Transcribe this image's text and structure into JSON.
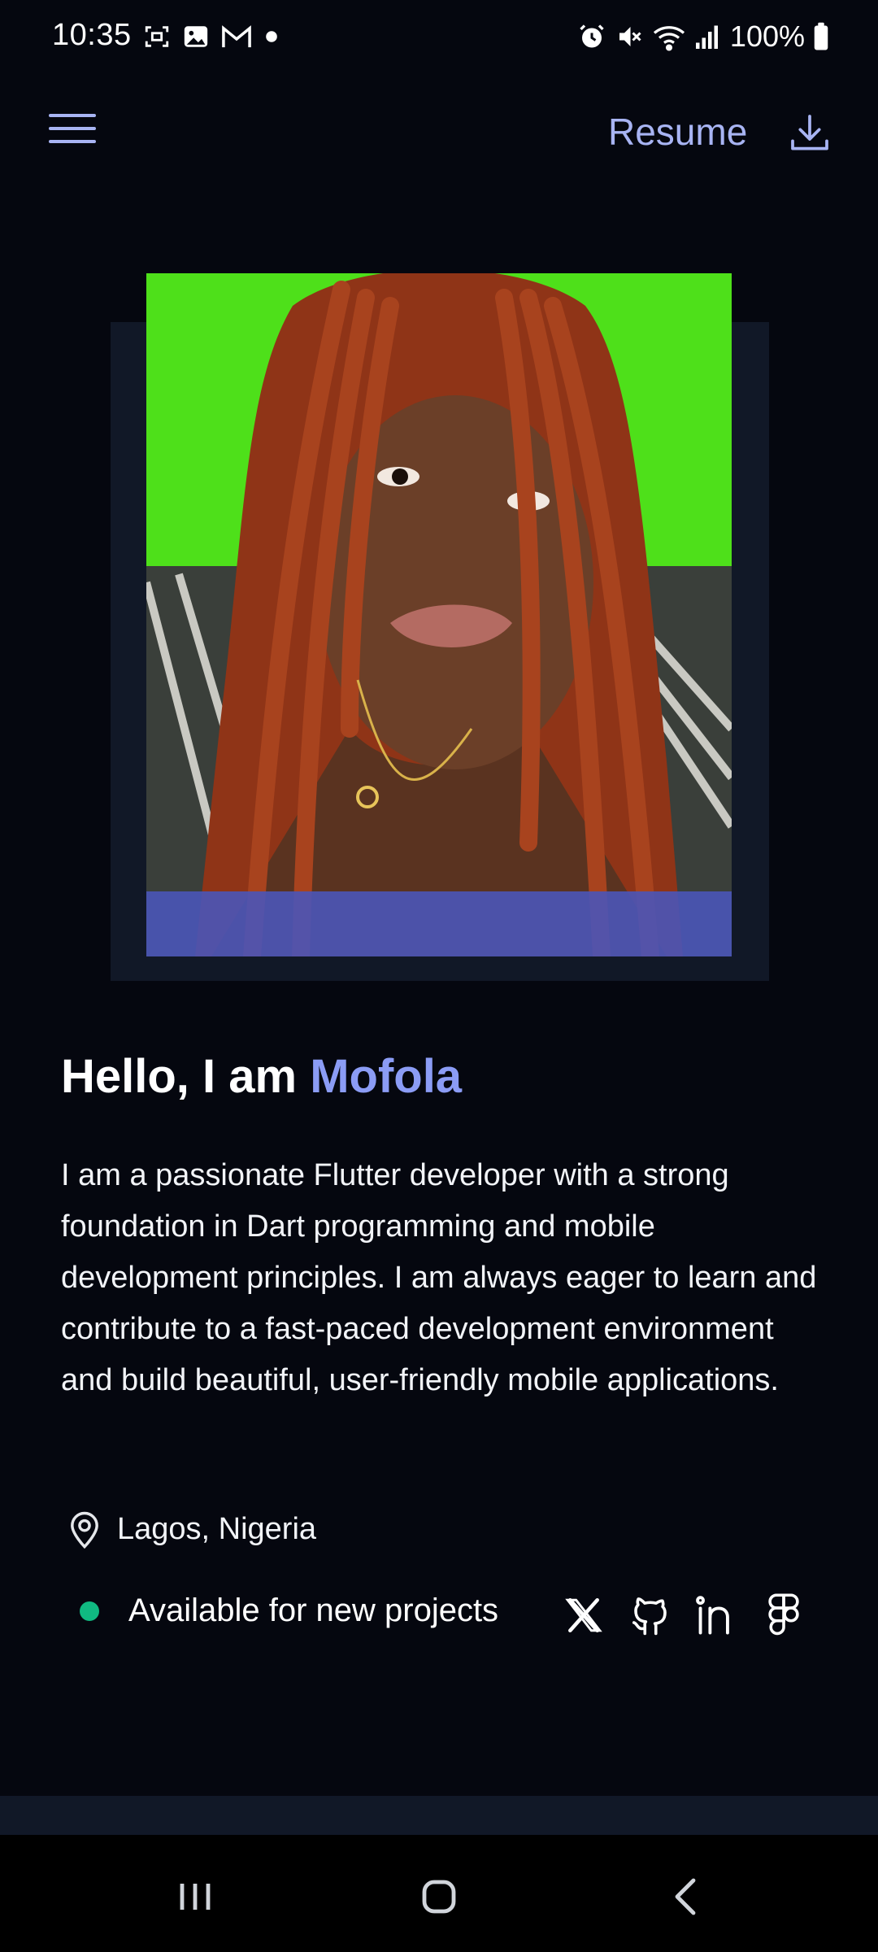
{
  "status_bar": {
    "time": "10:35",
    "left_icons": [
      "screenshot-icon",
      "gallery-icon",
      "gmail-icon",
      "dot-icon"
    ],
    "right_icons": [
      "alarm-icon",
      "mute-icon",
      "wifi-icon",
      "signal-icon",
      "battery-icon"
    ],
    "battery": "100%"
  },
  "app_bar": {
    "menu_icon": "hamburger-menu-icon",
    "resume_label": "Resume",
    "download_icon": "download-icon"
  },
  "profile": {
    "image_alt": "profile-photo"
  },
  "hero": {
    "greeting_prefix": "Hello, I am ",
    "name": "Mofola",
    "bio": "I am a passionate Flutter developer with a strong foundation in Dart programming and mobile development principles. I am always eager to learn and contribute to a fast-paced development environment and build beautiful, user-friendly mobile applications."
  },
  "location": {
    "icon": "location-pin-icon",
    "text": "Lagos, Nigeria"
  },
  "availability": {
    "text": "Available for new projects",
    "status_color": "#10b981"
  },
  "socials": [
    {
      "name": "x-icon"
    },
    {
      "name": "github-icon"
    },
    {
      "name": "linkedin-icon"
    },
    {
      "name": "figma-icon"
    }
  ],
  "nav": [
    "recents-icon",
    "home-icon",
    "back-icon"
  ],
  "colors": {
    "background": "#05070f",
    "accent": "#8b9cf5",
    "accent_light": "#a8b4f3",
    "card": "#111827"
  }
}
